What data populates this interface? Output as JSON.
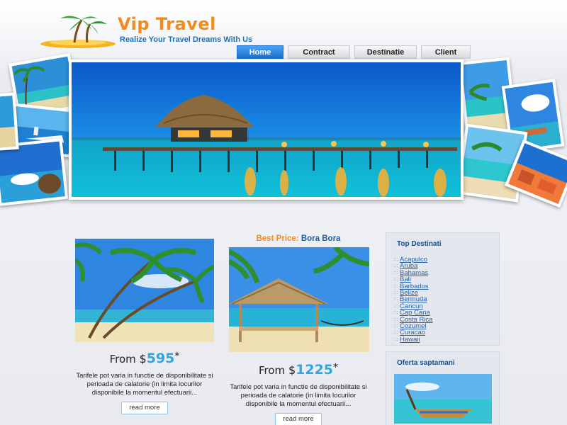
{
  "header": {
    "logo_title": "Vip Travel",
    "tagline": "Realize Your Travel Dreams With Us"
  },
  "nav": {
    "items": [
      {
        "label": "Home",
        "active": true
      },
      {
        "label": "Contract",
        "active": false
      },
      {
        "label": "Destinatie",
        "active": false
      },
      {
        "label": "Client",
        "active": false
      }
    ]
  },
  "colors": {
    "brand_orange": "#f28a1c",
    "brand_blue": "#1e6fb8",
    "price_blue": "#2ea7df",
    "nav_active": "#1a6fd0"
  },
  "offer1": {
    "price_prefix": "From",
    "currency": "$",
    "amount": "595",
    "asterisk": "*",
    "description": "Tarifele pot varia in functie de disponibilitate si perioada de calatorie (in limita locurilor disponibile la momentul efectuarii...",
    "button": "read more"
  },
  "offer2": {
    "best_price_label": "Best Price:",
    "best_price_value": "Bora Bora",
    "price_prefix": "From",
    "currency": "$",
    "amount": "1225",
    "asterisk": "*",
    "description": "Tarifele pot varia in functie de disponibilitate si perioada de calatorie (in limita locurilor disponibile la momentul efectuarii...",
    "button": "read more"
  },
  "sidebar": {
    "top_title": "Top Destinati",
    "destinations": [
      "Acapulco",
      "Aruba",
      "Bahamas",
      "Bali",
      "Barbados",
      "Belize",
      "Bermuda",
      "Cancun",
      "Cap Cana",
      "Costa Rica",
      "Cozumel",
      "Curacao",
      "Hawaii"
    ],
    "weekly_title": "Oferta saptamani"
  }
}
